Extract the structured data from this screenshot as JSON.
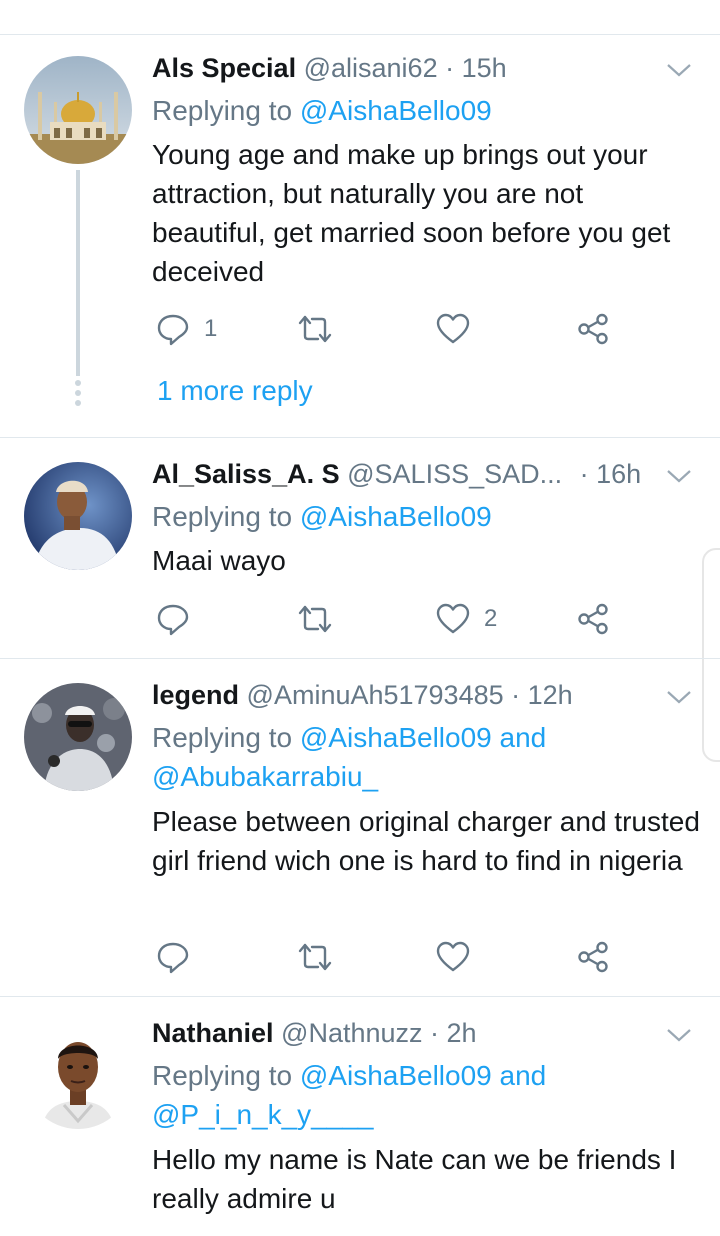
{
  "colors": {
    "accent": "#1da1f2",
    "secondary_text": "#657786",
    "divider": "#e1e8ed"
  },
  "more_reply_label": "1 more reply",
  "tweets": [
    {
      "name": "Als Special",
      "handle": "@alisani62",
      "time": "· 15h",
      "replying_prefix": "Replying to",
      "mentions": [
        "@AishaBello09"
      ],
      "and_word": "",
      "text": "Young age and make up brings out your attraction, but naturally you are not beautiful, get married soon before you get deceived",
      "reply_count": "1",
      "retweet_count": "",
      "like_count": ""
    },
    {
      "name": "Al_Saliss_A. S",
      "handle": "@SALISS_SAD...",
      "time": "· 16h",
      "replying_prefix": "Replying to",
      "mentions": [
        "@AishaBello09"
      ],
      "and_word": "",
      "text": "Maai wayo",
      "reply_count": "",
      "retweet_count": "",
      "like_count": "2"
    },
    {
      "name": "legend",
      "handle": "@AminuAh51793485",
      "time": "· 12h",
      "replying_prefix": "Replying to",
      "mentions": [
        "@AishaBello09",
        "@Abubakarrabiu_"
      ],
      "and_word": "and",
      "text": "Please between original charger and trusted girl friend wich one is hard to find in nigeria",
      "reply_count": "",
      "retweet_count": "",
      "like_count": ""
    },
    {
      "name": "Nathaniel",
      "handle": "@Nathnuzz",
      "time": "· 2h",
      "replying_prefix": "Replying to",
      "mentions": [
        "@AishaBello09",
        "@P_i_n_k_y____"
      ],
      "and_word": "and",
      "text": "Hello my name is Nate can we be friends I really admire u",
      "reply_count": "",
      "retweet_count": "",
      "like_count": ""
    }
  ]
}
